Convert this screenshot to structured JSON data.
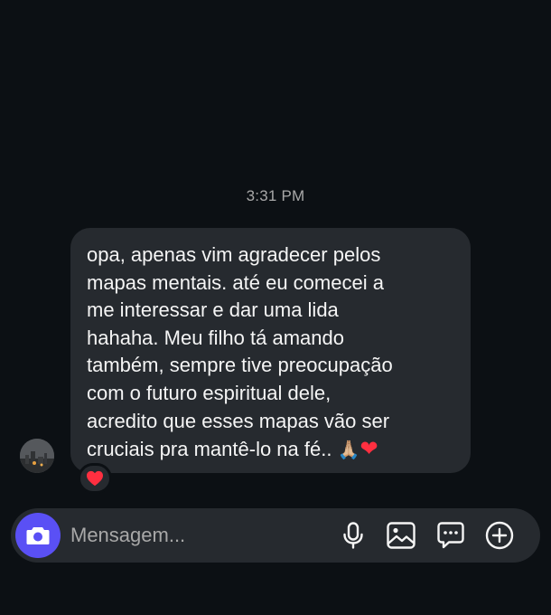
{
  "conversation": {
    "timestamp": "3:31 PM",
    "message": {
      "text": "opa, apenas vim agradecer pelos\nmapas mentais. até eu comecei a\nme interessar e dar uma lida\nhahaha. Meu filho tá amando\ntambém, sempre tive preocupação\ncom o futuro espiritual dele,\nacredito que esses mapas vão ser\ncruciais pra mantê-lo na fé.. ",
      "emoji_pray": "🙏🏼",
      "emoji_heart": "❤",
      "reaction": "heart-icon"
    }
  },
  "composer": {
    "placeholder": "Mensagem...",
    "icons": [
      "camera-icon",
      "microphone-icon",
      "gallery-icon",
      "sticker-icon",
      "plus-icon"
    ]
  },
  "colors": {
    "background": "#0c1014",
    "bubble": "#262a2f",
    "accent": "#5a50f5",
    "heart": "#ff2f40",
    "muted_text": "#a8a8a8"
  }
}
